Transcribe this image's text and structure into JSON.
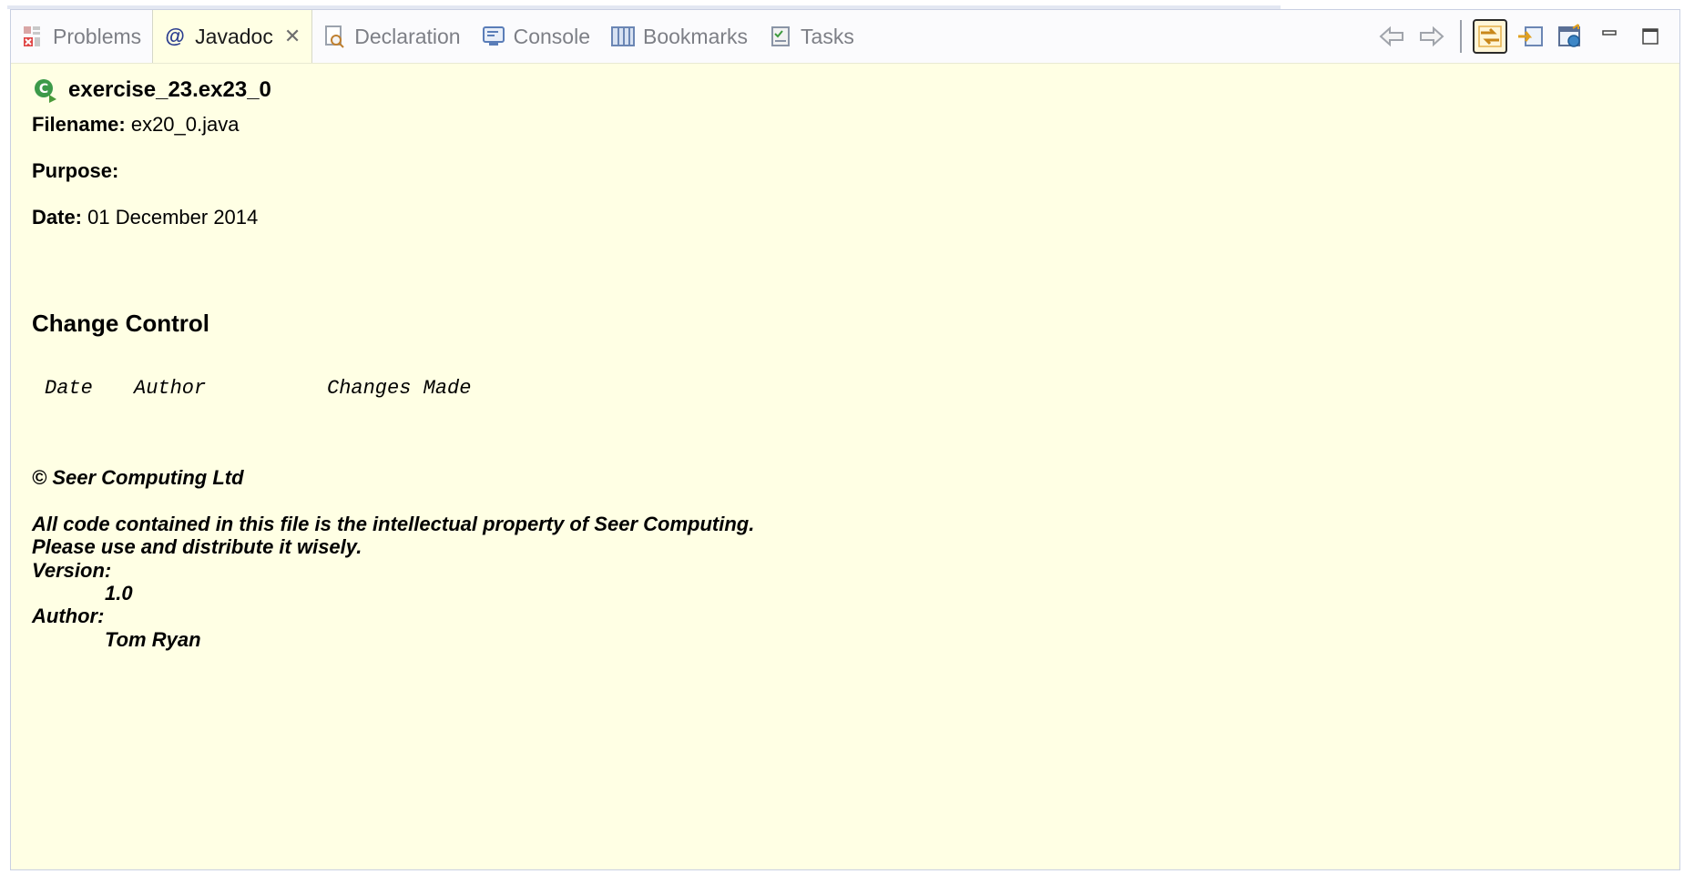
{
  "tabs": [
    {
      "label": "Problems",
      "icon": "problems-icon",
      "active": false
    },
    {
      "label": "Javadoc",
      "icon": "at-sign-icon",
      "active": true,
      "closable": true
    },
    {
      "label": "Declaration",
      "icon": "declaration-icon",
      "active": false
    },
    {
      "label": "Console",
      "icon": "console-icon",
      "active": false
    },
    {
      "label": "Bookmarks",
      "icon": "bookmarks-icon",
      "active": false
    },
    {
      "label": "Tasks",
      "icon": "tasks-icon",
      "active": false
    }
  ],
  "toolbar": {
    "back": "back-arrow-icon",
    "forward": "forward-arrow-icon",
    "link": "link-with-selection-icon",
    "open_input": "open-input-icon",
    "open_browser": "open-in-browser-icon",
    "minimize": "minimize-icon",
    "maximize": "maximize-icon"
  },
  "doc": {
    "title": "exercise_23.ex23_0",
    "filename_label": "Filename:",
    "filename_value": "ex20_0.java",
    "purpose_label": "Purpose:",
    "date_label": "Date:",
    "date_value": "01 December 2014",
    "section_heading": "Change Control",
    "table_headers": [
      "Date",
      "Author",
      "Changes Made"
    ],
    "copyright": "© Seer Computing Ltd",
    "ip_line1": "All code contained in this file is the intellectual property of Seer Computing.",
    "ip_line2": "Please use and distribute it wisely.",
    "version_label": "Version:",
    "version_value": "1.0",
    "author_label": "Author:",
    "author_value": "Tom Ryan"
  },
  "colors": {
    "content_bg": "#ffffe4",
    "tabbar_bg": "#fbfbfd",
    "accent": "#f0a020"
  }
}
